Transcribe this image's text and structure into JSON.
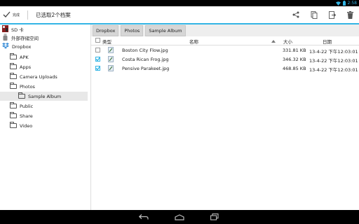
{
  "status": {
    "time": "2:58"
  },
  "actionbar": {
    "done_label": "完成",
    "selection_title": "已选取2个档案",
    "icons": [
      "share-icon",
      "copy-icon",
      "move-icon",
      "delete-icon"
    ]
  },
  "sidebar": {
    "items": [
      {
        "label": "SD 卡",
        "icon": "sd-card-icon"
      },
      {
        "label": "外部存储空间",
        "icon": "usb-storage-icon"
      },
      {
        "label": "Dropbox",
        "icon": "dropbox-icon"
      },
      {
        "label": "APK",
        "icon": "folder-icon"
      },
      {
        "label": "Apps",
        "icon": "folder-icon"
      },
      {
        "label": "Camera Uploads",
        "icon": "folder-icon"
      },
      {
        "label": "Photos",
        "icon": "folder-icon"
      },
      {
        "label": "Sample Album",
        "icon": "folder-icon"
      },
      {
        "label": "Public",
        "icon": "folder-icon"
      },
      {
        "label": "Share",
        "icon": "folder-icon"
      },
      {
        "label": "Video",
        "icon": "folder-icon"
      }
    ]
  },
  "breadcrumb": [
    "Dropbox",
    "Photos",
    "Sample Album"
  ],
  "table": {
    "headers": {
      "type": "类型",
      "name": "名称",
      "size": "大小",
      "date": "日期"
    },
    "rows": [
      {
        "name": "Boston City Flow.jpg",
        "size": "331.81 KB",
        "date": "13-4-22 下午12:03:01",
        "checked": false
      },
      {
        "name": "Costa Rican Frog.jpg",
        "size": "346.32 KB",
        "date": "13-4-22 下午12:03:01",
        "checked": true
      },
      {
        "name": "Pensive Parakeet.jpg",
        "size": "468.85 KB",
        "date": "13-4-22 下午12:03:01",
        "checked": true
      }
    ]
  },
  "colors": {
    "accent": "#33b5e5",
    "statusbar": "#000000"
  }
}
